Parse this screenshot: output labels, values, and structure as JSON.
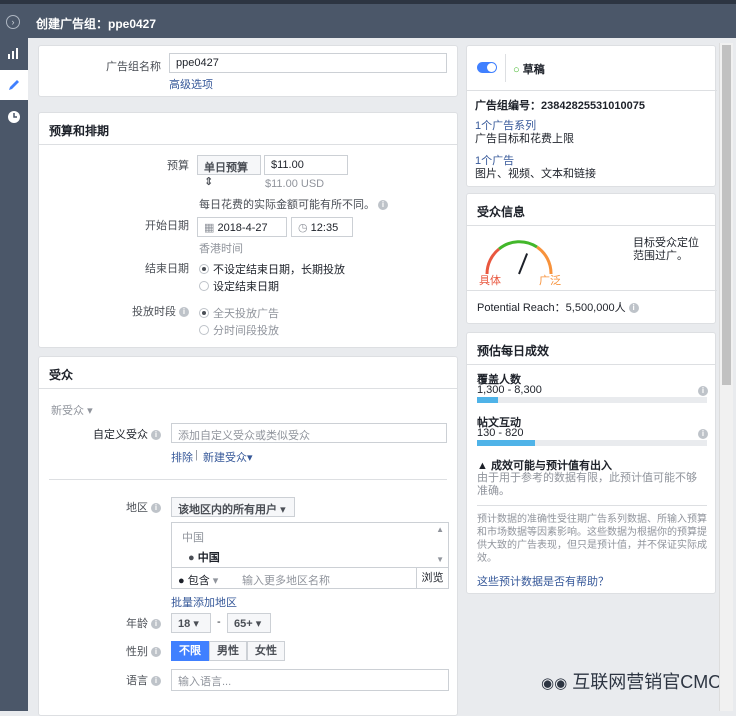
{
  "header": {
    "title": "创建广告组：ppe0427"
  },
  "adset_name": {
    "label": "广告组名称",
    "value": "ppe0427",
    "advanced": "高级选项"
  },
  "budget": {
    "section_title": "预算和排期",
    "budget_label": "预算",
    "budget_type": "单日预算",
    "amount": "$11.00",
    "amount_usd": "$11.00 USD",
    "note": "每日花费的实际金额可能有所不同。",
    "start_label": "开始日期",
    "start_date": "2018-4-27",
    "start_time": "12:35",
    "timezone": "香港时间",
    "end_label": "结束日期",
    "end_opt1": "不设定结束日期，长期投放",
    "end_opt2": "设定结束日期",
    "schedule_label": "投放时段",
    "schedule_opt1": "全天投放广告",
    "schedule_opt2": "分时间段投放"
  },
  "audience": {
    "section_title": "受众",
    "new_audience": "新受众",
    "custom_label": "自定义受众",
    "custom_placeholder": "添加自定义受众或类似受众",
    "exclude": "排除",
    "create_new": "新建受众",
    "location_label": "地区",
    "location_type": "该地区内的所有用户",
    "loc_group": "中国",
    "loc_item": "中国",
    "include": "包含",
    "loc_placeholder": "输入更多地区名称",
    "browse": "浏览",
    "bulk_add": "批量添加地区",
    "age_label": "年龄",
    "age_min": "18",
    "age_max": "65+",
    "age_dash": "-",
    "gender_label": "性别",
    "gender_all": "不限",
    "gender_male": "男性",
    "gender_female": "女性",
    "lang_label": "语言",
    "lang_placeholder": "输入语言..."
  },
  "status_card": {
    "status": "草稿",
    "id_line": "广告组编号：23842825531010075",
    "campaign_link": "1个广告系列",
    "campaign_desc": "广告目标和花费上限",
    "ad_link": "1个广告",
    "ad_desc": "图片、视频、文本和链接"
  },
  "audience_info": {
    "title": "受众信息",
    "gauge_left": "具体",
    "gauge_right": "广泛",
    "gauge_level": 0.62,
    "desc": "目标受众定位范围过广。",
    "reach": "Potential Reach：5,500,000人"
  },
  "daily_results": {
    "title": "预估每日成效",
    "reach_label": "覆盖人数",
    "reach_range": "1,300 - 8,300",
    "reach_level": 0.09,
    "engage_label": "帖文互动",
    "engage_range": "130 - 820",
    "engage_level": 0.25,
    "warn_title": "成效可能与预计值有出入",
    "warn_desc": "由于用于参考的数据有限，此预计值可能不够准确。",
    "disclaimer": "预计数据的准确性受往期广告系列数据、所输入预算和市场数据等因素影响。这些数据为根据你的预算提供大致的广告表现，但只是预计值，并不保证实际成效。",
    "help_link": "这些预计数据是否有帮助？"
  },
  "watermark": "互联网营销官CMO"
}
